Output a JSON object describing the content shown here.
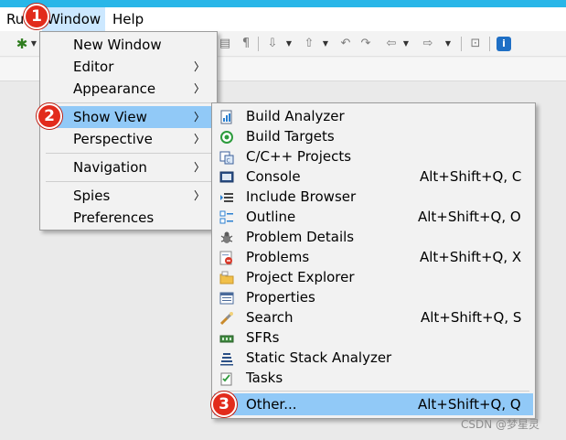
{
  "menubar": {
    "items": [
      "Ru",
      "Window",
      "Help"
    ]
  },
  "window_menu": {
    "items": [
      {
        "label": "New Window",
        "submenu": false
      },
      {
        "label": "Editor",
        "submenu": true
      },
      {
        "label": "Appearance",
        "submenu": true
      },
      {
        "label": "Show View",
        "submenu": true
      },
      {
        "label": "Perspective",
        "submenu": true
      },
      {
        "label": "Navigation",
        "submenu": true
      },
      {
        "label": "Spies",
        "submenu": true
      },
      {
        "label": "Preferences",
        "submenu": false
      }
    ]
  },
  "show_view_menu": {
    "items": [
      {
        "label": "Build Analyzer",
        "shortcut": "",
        "icon": "build-analyzer-icon"
      },
      {
        "label": "Build Targets",
        "shortcut": "",
        "icon": "build-targets-icon"
      },
      {
        "label": "C/C++ Projects",
        "shortcut": "",
        "icon": "cpp-projects-icon"
      },
      {
        "label": "Console",
        "shortcut": "Alt+Shift+Q, C",
        "icon": "console-icon"
      },
      {
        "label": "Include Browser",
        "shortcut": "",
        "icon": "include-browser-icon"
      },
      {
        "label": "Outline",
        "shortcut": "Alt+Shift+Q, O",
        "icon": "outline-icon"
      },
      {
        "label": "Problem Details",
        "shortcut": "",
        "icon": "problem-details-icon"
      },
      {
        "label": "Problems",
        "shortcut": "Alt+Shift+Q, X",
        "icon": "problems-icon"
      },
      {
        "label": "Project Explorer",
        "shortcut": "",
        "icon": "project-explorer-icon"
      },
      {
        "label": "Properties",
        "shortcut": "",
        "icon": "properties-icon"
      },
      {
        "label": "Search",
        "shortcut": "Alt+Shift+Q, S",
        "icon": "search-icon"
      },
      {
        "label": "SFRs",
        "shortcut": "",
        "icon": "sfrs-icon"
      },
      {
        "label": "Static Stack Analyzer",
        "shortcut": "",
        "icon": "static-stack-icon"
      },
      {
        "label": "Tasks",
        "shortcut": "",
        "icon": "tasks-icon"
      },
      {
        "label": "Other...",
        "shortcut": "Alt+Shift+Q, Q",
        "icon": ""
      }
    ]
  },
  "annotations": [
    "1",
    "2",
    "3"
  ],
  "watermark": "CSDN @梦星灵",
  "colors": {
    "menu_highlight": "#91c9f7",
    "menubar_active": "#cce8ff",
    "badge_red": "#e22b1c",
    "title_strip": "#29b6e8"
  }
}
